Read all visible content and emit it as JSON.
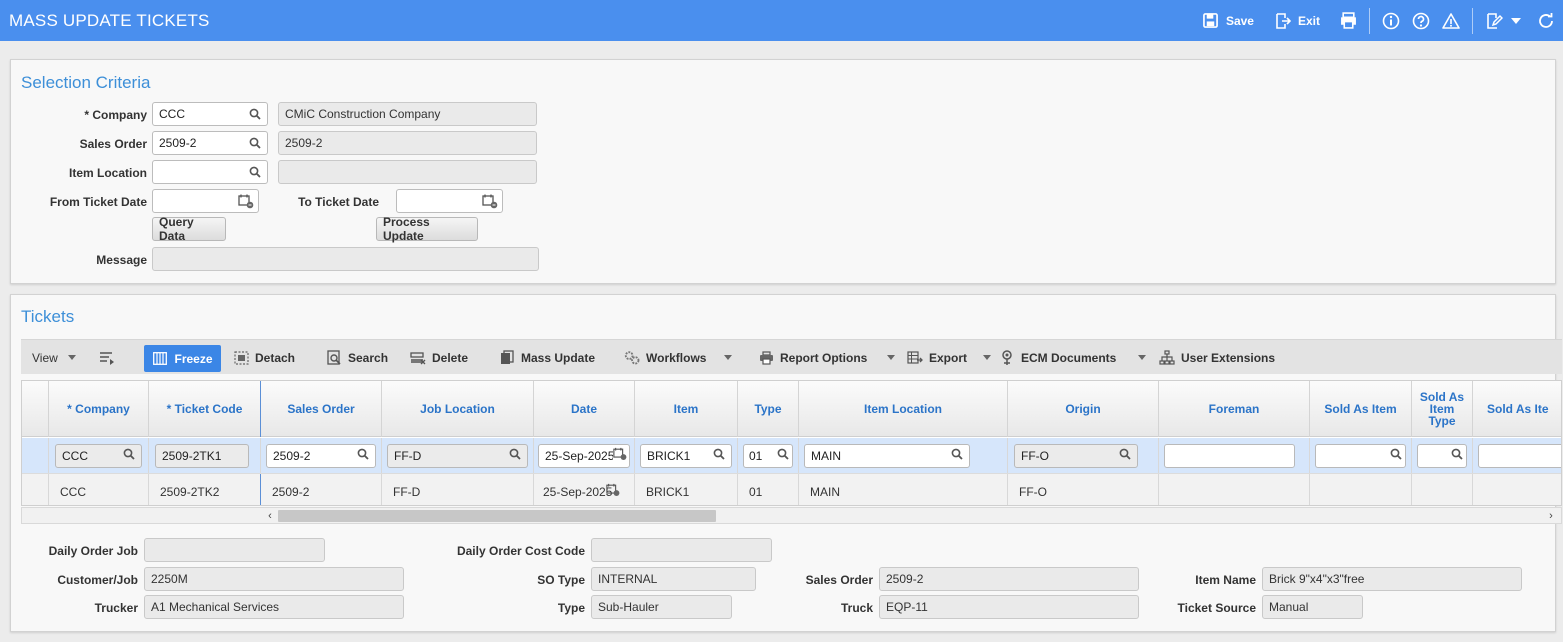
{
  "header": {
    "title": "MASS UPDATE TICKETS",
    "save_label": "Save",
    "exit_label": "Exit"
  },
  "selection": {
    "title": "Selection Criteria",
    "company_label": "* Company",
    "company_value": "CCC",
    "company_name": "CMiC Construction Company",
    "sales_order_label": "Sales Order",
    "sales_order_value": "2509-2",
    "sales_order_desc": "2509-2",
    "item_location_label": "Item Location",
    "item_location_value": "",
    "item_location_desc": "",
    "from_date_label": "From Ticket Date",
    "from_date_value": "",
    "to_date_label": "To Ticket Date",
    "to_date_value": "",
    "query_button": "Query Data",
    "process_button": "Process Update",
    "message_label": "Message",
    "message_value": ""
  },
  "tickets": {
    "title": "Tickets",
    "toolbar": {
      "view": "View",
      "freeze": "Freeze",
      "detach": "Detach",
      "search": "Search",
      "delete": "Delete",
      "mass_update": "Mass Update",
      "workflows": "Workflows",
      "report_options": "Report Options",
      "export": "Export",
      "ecm_documents": "ECM Documents",
      "user_extensions": "User Extensions"
    },
    "columns": {
      "company": "* Company",
      "ticket_code": "* Ticket Code",
      "sales_order": "Sales Order",
      "job_location": "Job Location",
      "date": "Date",
      "item": "Item",
      "type": "Type",
      "item_location": "Item Location",
      "origin": "Origin",
      "foreman": "Foreman",
      "sold_as_item": "Sold As Item",
      "sold_as_item_type": "Sold As Item Type",
      "sold_as_item_more": "Sold As Ite"
    },
    "rows": [
      {
        "company": "CCC",
        "ticket_code": "2509-2TK1",
        "sales_order": "2509-2",
        "job_location": "FF-D",
        "date": "25-Sep-2025",
        "item": "BRICK1",
        "type": "01",
        "item_location": "MAIN",
        "origin": "FF-O",
        "foreman": "",
        "sold_as_item": "",
        "sold_as_item_type": "",
        "sold_as_item_more": ""
      },
      {
        "company": "CCC",
        "ticket_code": "2509-2TK2",
        "sales_order": "2509-2",
        "job_location": "FF-D",
        "date": "25-Sep-2025",
        "item": "BRICK1",
        "type": "01",
        "item_location": "MAIN",
        "origin": "FF-O",
        "foreman": "",
        "sold_as_item": "",
        "sold_as_item_type": "",
        "sold_as_item_more": ""
      }
    ]
  },
  "details": {
    "daily_order_job_label": "Daily Order Job",
    "daily_order_job_value": "",
    "daily_order_cost_code_label": "Daily Order Cost Code",
    "daily_order_cost_code_value": "",
    "customer_job_label": "Customer/Job",
    "customer_job_value": "2250M",
    "so_type_label": "SO Type",
    "so_type_value": "INTERNAL",
    "sales_order_label": "Sales Order",
    "sales_order_value": "2509-2",
    "item_name_label": "Item Name",
    "item_name_value": "Brick 9\"x4\"x3\"free",
    "trucker_label": "Trucker",
    "trucker_value": "A1 Mechanical Services",
    "type_label": "Type",
    "type_value": "Sub-Hauler",
    "truck_label": "Truck",
    "truck_value": "EQP-11",
    "ticket_source_label": "Ticket Source",
    "ticket_source_value": "Manual"
  },
  "colors": {
    "header_bg": "#4a8fee",
    "title_blue": "#3d8fd8",
    "column_blue": "#2b74c8",
    "freeze_bg": "#3b86e6",
    "selected_row": "#d6e6fb"
  }
}
